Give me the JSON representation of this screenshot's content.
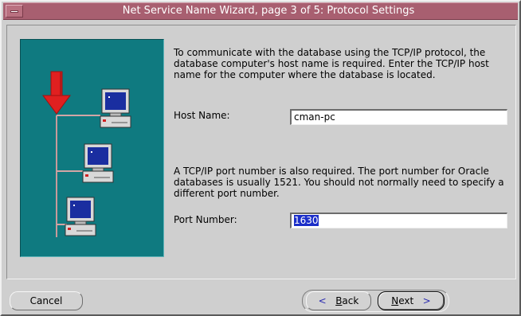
{
  "window": {
    "title": "Net Service Name Wizard, page 3 of 5: Protocol Settings"
  },
  "intro_text": "To communicate with the database using the TCP/IP protocol, the database computer's host name is required.  Enter the TCP/IP host name for the computer where the database is located.",
  "host": {
    "label": "Host Name:",
    "value": "cman-pc"
  },
  "port_text": "A TCP/IP port number is also required.  The port number for Oracle databases is usually 1521.  You should not normally need to specify a different port number.",
  "port": {
    "label": "Port Number:",
    "value": "1630"
  },
  "buttons": {
    "cancel": "Cancel",
    "back_mnemonic": "B",
    "back_rest": "ack",
    "next_mnemonic": "N",
    "next_rest": "ext"
  },
  "colors": {
    "titlebar": "#a85f70",
    "illustration_bg": "#0f7a80",
    "arrow": "#e02020",
    "selection": "#1b2ec9"
  },
  "icons": [
    "window-menu-icon",
    "computer-icon",
    "red-arrow-icon",
    "chevron-left-icon",
    "chevron-right-icon"
  ]
}
